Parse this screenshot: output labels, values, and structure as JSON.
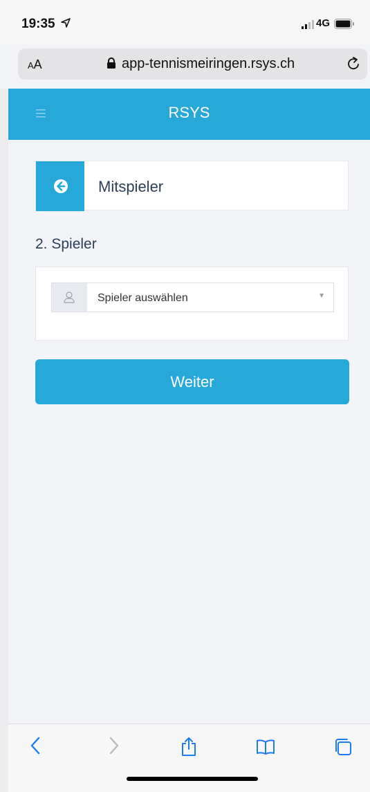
{
  "status_bar": {
    "time": "19:35",
    "network": "4G"
  },
  "browser": {
    "aa_large": "A",
    "aa_small": "A",
    "url": "app-tennismeiringen.rsys.ch"
  },
  "app": {
    "title": "RSYS"
  },
  "page": {
    "title": "Mitspieler",
    "section_title": "2. Spieler",
    "select_placeholder": "Spieler auswählen",
    "next_button": "Weiter"
  },
  "colors": {
    "accent": "#26a8d9",
    "text": "#2c3e57",
    "background": "#f3f4f7"
  },
  "icons": {
    "back": "circle-arrow-left-icon",
    "user": "user-icon",
    "menu": "hamburger-menu-icon",
    "toolbar": [
      "back-icon",
      "forward-icon",
      "share-icon",
      "bookmarks-icon",
      "tabs-icon"
    ]
  }
}
